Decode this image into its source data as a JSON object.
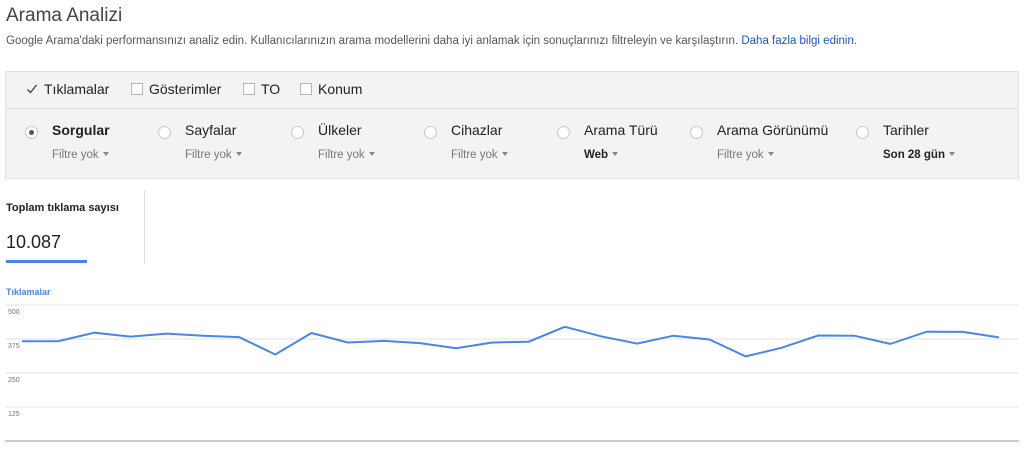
{
  "header": {
    "title": "Arama Analizi",
    "description": "Google Arama'daki performansınızı analiz edin. Kullanıcılarınızın arama modellerini daha iyi anlamak için sonuçlarınızı filtreleyin ve karşılaştırın.",
    "learn_more": "Daha fazla bilgi edinin."
  },
  "metrics": [
    {
      "label": "Tıklamalar",
      "checked": true
    },
    {
      "label": "Gösterimler",
      "checked": false
    },
    {
      "label": "TO",
      "checked": false
    },
    {
      "label": "Konum",
      "checked": false
    }
  ],
  "dimensions": [
    {
      "label": "Sorgular",
      "sub": "Filtre yok",
      "selected": true
    },
    {
      "label": "Sayfalar",
      "sub": "Filtre yok",
      "selected": false
    },
    {
      "label": "Ülkeler",
      "sub": "Filtre yok",
      "selected": false
    },
    {
      "label": "Cihazlar",
      "sub": "Filtre yok",
      "selected": false
    },
    {
      "label": "Arama Türü",
      "sub": "Web",
      "selected": false
    },
    {
      "label": "Arama Görünümü",
      "sub": "Filtre yok",
      "selected": false
    },
    {
      "label": "Tarihler",
      "sub": "Son 28 gün",
      "selected": false
    }
  ],
  "summary": {
    "label": "Toplam tıklama sayısı",
    "value": "10.087"
  },
  "colors": {
    "accent": "#4a86e8",
    "link": "#1a56c9",
    "panel_bg": "#f3f3f3"
  },
  "chart_data": {
    "type": "line",
    "series": [
      {
        "name": "Tıklamalar",
        "values": [
          367,
          367,
          398,
          384,
          395,
          387,
          382,
          318,
          397,
          362,
          368,
          360,
          341,
          362,
          365,
          420,
          385,
          358,
          387,
          373,
          311,
          343,
          388,
          387,
          357,
          402,
          401,
          381
        ]
      }
    ],
    "yticks": [
      500,
      375,
      250,
      125
    ],
    "ylim": [
      0,
      500
    ],
    "grid": true,
    "xlabel": "",
    "ylabel": ""
  }
}
